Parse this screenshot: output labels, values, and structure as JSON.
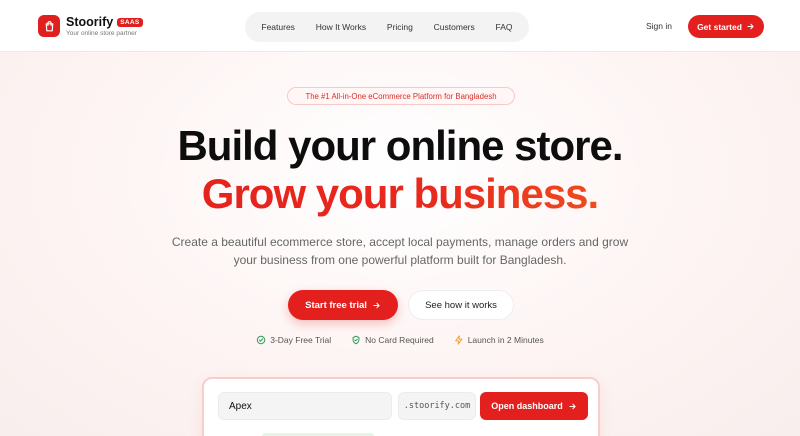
{
  "header": {
    "brand_name": "Stoorify",
    "brand_badge": "SAAS",
    "tagline": "Your online store partner",
    "nav": [
      "Features",
      "How It Works",
      "Pricing",
      "Customers",
      "FAQ"
    ],
    "signin": "Sign in",
    "cta": "Get started"
  },
  "hero": {
    "promo": "The #1 All-in-One eCommerce Platform for Bangladesh",
    "headline_1": "Build your online store.",
    "headline_2": "Grow your business.",
    "subtitle": "Create a beautiful ecommerce store, accept local payments, manage orders and grow your business from one powerful platform built for Bangladesh.",
    "primary_cta": "Start free trial",
    "secondary_cta": "See how it works",
    "perks": [
      "3-Day Free Trial",
      "No Card Required",
      "Launch in 2 Minutes"
    ]
  },
  "signup_card": {
    "store_name_value": "Apex",
    "domain_suffix": ".stoorify.com",
    "button": "Open dashboard"
  },
  "colors": {
    "accent": "#e3201e",
    "gradient_end": "#f4781f",
    "check": "#2e9d5b",
    "bolt": "#f2a23a"
  }
}
